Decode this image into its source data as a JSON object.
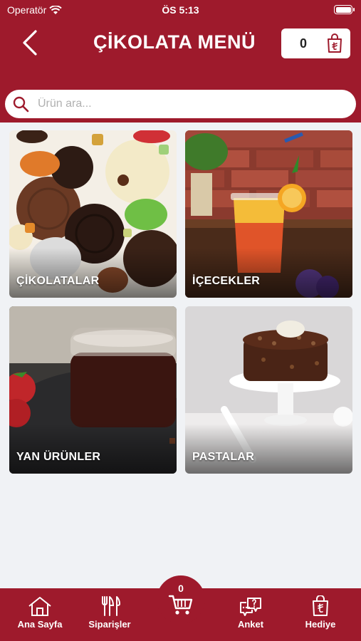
{
  "status": {
    "carrier": "Operatör",
    "time": "ÖS 5:13"
  },
  "header": {
    "title": "ÇİKOLATA MENÜ",
    "cart_count": "0"
  },
  "search": {
    "placeholder": "Ürün ara..."
  },
  "categories": [
    {
      "label": "ÇİKOLATALAR"
    },
    {
      "label": "İÇECEKLER"
    },
    {
      "label": "YAN ÜRÜNLER"
    },
    {
      "label": "PASTALAR"
    }
  ],
  "tabbar": {
    "items": [
      {
        "label": "Ana Sayfa"
      },
      {
        "label": "Siparişler"
      },
      {
        "label": "Anket"
      },
      {
        "label": "Hediye"
      }
    ],
    "cart_count": "0"
  },
  "colors": {
    "brand": "#9e1a2c",
    "background": "#f0f2f5"
  }
}
